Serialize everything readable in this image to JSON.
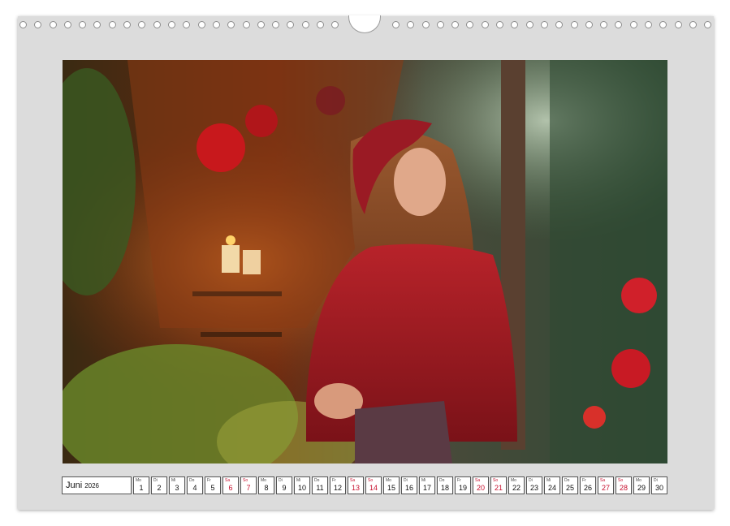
{
  "calendar": {
    "month": "Juni",
    "year": "2026",
    "accent_color": "#c8102e",
    "days": [
      {
        "wd": "Mo",
        "num": "1",
        "weekend": false
      },
      {
        "wd": "Di",
        "num": "2",
        "weekend": false
      },
      {
        "wd": "Mi",
        "num": "3",
        "weekend": false
      },
      {
        "wd": "Do",
        "num": "4",
        "weekend": false
      },
      {
        "wd": "Fr",
        "num": "5",
        "weekend": false
      },
      {
        "wd": "Sa",
        "num": "6",
        "weekend": true
      },
      {
        "wd": "So",
        "num": "7",
        "weekend": true
      },
      {
        "wd": "Mo",
        "num": "8",
        "weekend": false
      },
      {
        "wd": "Di",
        "num": "9",
        "weekend": false
      },
      {
        "wd": "Mi",
        "num": "10",
        "weekend": false
      },
      {
        "wd": "Do",
        "num": "11",
        "weekend": false
      },
      {
        "wd": "Fr",
        "num": "12",
        "weekend": false
      },
      {
        "wd": "Sa",
        "num": "13",
        "weekend": true
      },
      {
        "wd": "So",
        "num": "14",
        "weekend": true
      },
      {
        "wd": "Mo",
        "num": "15",
        "weekend": false
      },
      {
        "wd": "Di",
        "num": "16",
        "weekend": false
      },
      {
        "wd": "Mi",
        "num": "17",
        "weekend": false
      },
      {
        "wd": "Do",
        "num": "18",
        "weekend": false
      },
      {
        "wd": "Fr",
        "num": "19",
        "weekend": false
      },
      {
        "wd": "Sa",
        "num": "20",
        "weekend": true
      },
      {
        "wd": "So",
        "num": "21",
        "weekend": true
      },
      {
        "wd": "Mo",
        "num": "22",
        "weekend": false
      },
      {
        "wd": "Di",
        "num": "23",
        "weekend": false
      },
      {
        "wd": "Mi",
        "num": "24",
        "weekend": false
      },
      {
        "wd": "Do",
        "num": "25",
        "weekend": false
      },
      {
        "wd": "Fr",
        "num": "26",
        "weekend": false
      },
      {
        "wd": "Sa",
        "num": "27",
        "weekend": true
      },
      {
        "wd": "So",
        "num": "28",
        "weekend": true
      },
      {
        "wd": "Mo",
        "num": "29",
        "weekend": false
      },
      {
        "wd": "Di",
        "num": "30",
        "weekend": false
      }
    ]
  }
}
